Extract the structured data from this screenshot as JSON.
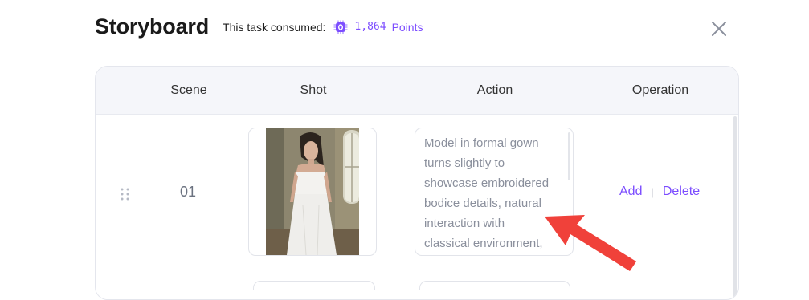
{
  "header": {
    "title": "Storyboard",
    "consumed_label": "This task consumed:",
    "points_value": "1,864",
    "points_label": "Points",
    "coin_icon": "chip-coin-icon",
    "close_icon": "close-icon"
  },
  "table": {
    "columns": [
      "Scene",
      "Shot",
      "Action",
      "Operation"
    ],
    "rows": [
      {
        "scene": "01",
        "shot_icon": "photo-woman-in-white-strapless-gown",
        "action": "Model in formal gown\nturns slightly to\nshowcase embroidered\nbodice details, natural\ninteraction with\nclassical environment,",
        "add_label": "Add",
        "separator": "|",
        "delete_label": "Delete"
      }
    ]
  },
  "colors": {
    "accent": "#7c4dff",
    "header_bg": "#f5f6fa",
    "annotation_arrow": "#f0413a"
  }
}
